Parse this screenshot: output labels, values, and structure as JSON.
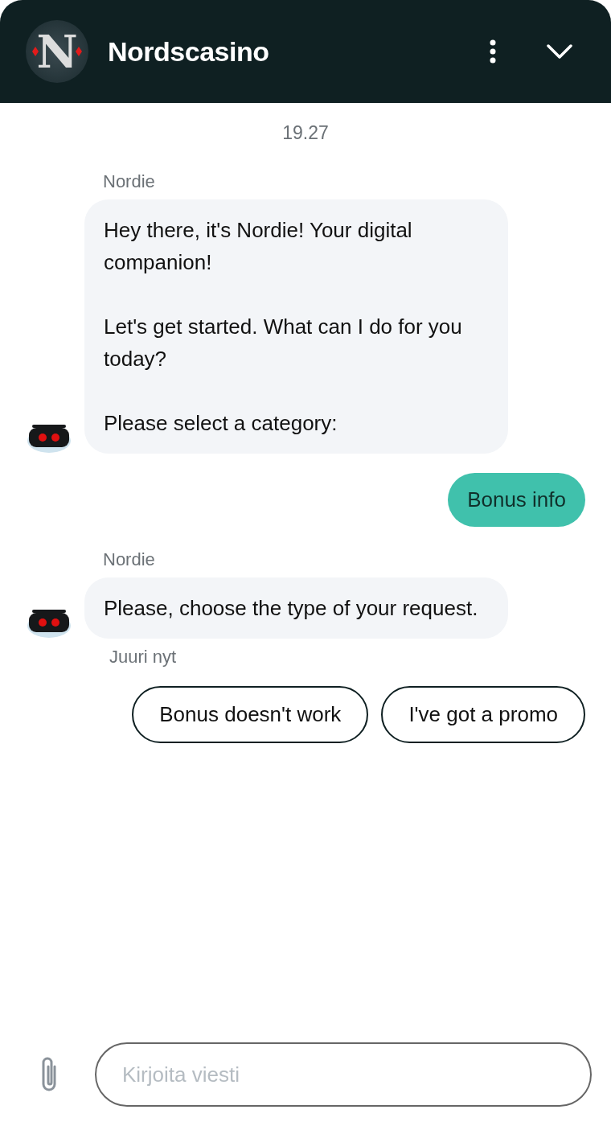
{
  "header": {
    "logo_letter": "N",
    "title": "Nordscasino"
  },
  "timestamp": "19.27",
  "messages": [
    {
      "kind": "bot",
      "sender": "Nordie",
      "paragraphs": [
        "Hey there, it's Nordie! Your digital companion!",
        "Let's get started. What can I do for you today?",
        "Please select a category:"
      ]
    },
    {
      "kind": "user",
      "paragraphs": [
        "Bonus info"
      ]
    },
    {
      "kind": "bot",
      "sender": "Nordie",
      "paragraphs": [
        "Please, choose the type of your request."
      ],
      "status": "Juuri nyt"
    }
  ],
  "quick_replies": [
    "Bonus doesn't work",
    "I've got a promo"
  ],
  "composer": {
    "placeholder": "Kirjoita viesti"
  }
}
